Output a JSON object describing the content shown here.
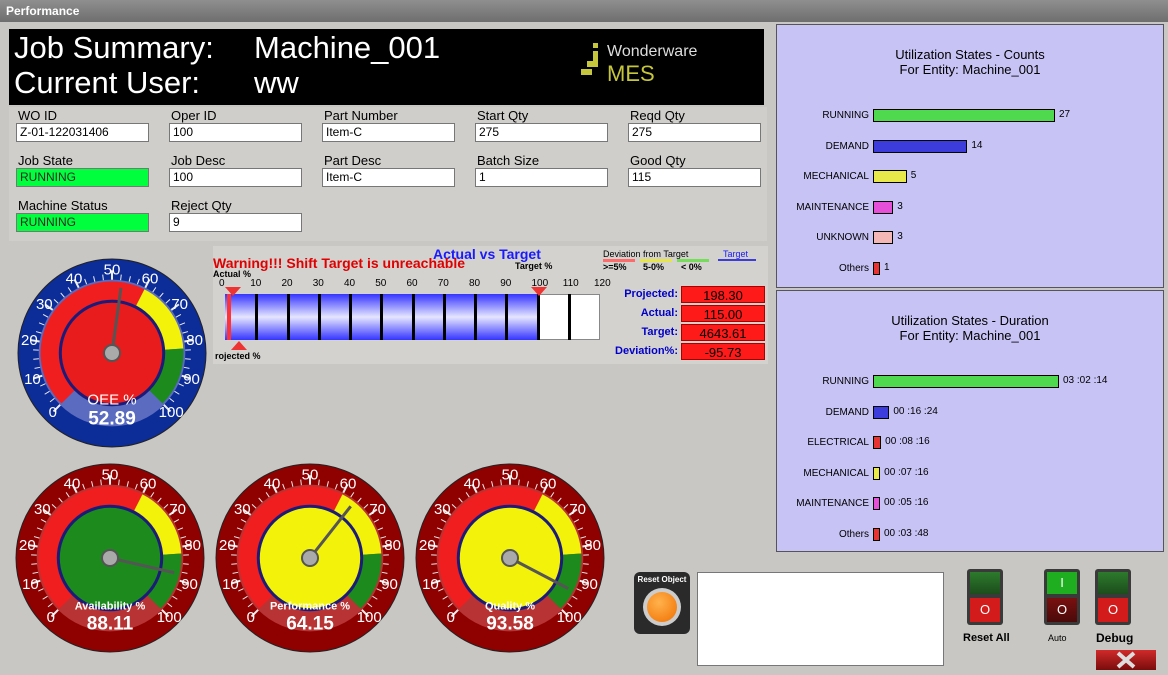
{
  "window": {
    "title": "Performance"
  },
  "header": {
    "job_label": "Job Summary:",
    "job_value": "Machine_001",
    "user_label": "Current User:",
    "user_value": "ww",
    "logo_top": "Wonderware",
    "logo_bottom": "MES"
  },
  "fields": {
    "wo_id": {
      "label": "WO ID",
      "value": "Z-01-122031406"
    },
    "oper_id": {
      "label": "Oper ID",
      "value": "100"
    },
    "part_number": {
      "label": "Part Number",
      "value": "Item-C"
    },
    "start_qty": {
      "label": "Start Qty",
      "value": "275"
    },
    "reqd_qty": {
      "label": "Reqd Qty",
      "value": "275"
    },
    "job_state": {
      "label": "Job State",
      "value": "RUNNING"
    },
    "job_desc": {
      "label": "Job Desc",
      "value": "100"
    },
    "part_desc": {
      "label": "Part Desc",
      "value": "Item-C"
    },
    "batch_size": {
      "label": "Batch Size",
      "value": "1"
    },
    "good_qty": {
      "label": "Good Qty",
      "value": "115"
    },
    "machine_status": {
      "label": "Machine Status",
      "value": "RUNNING"
    },
    "reject_qty": {
      "label": "Reject Qty",
      "value": "9"
    }
  },
  "actual_vs_target": {
    "title": "Actual vs Target",
    "warning": "Warning!!! Shift Target is unreachable",
    "actual_pct_label": "Actual %",
    "target_pct_label": "Target %",
    "projected_pct_label": "rojected %",
    "legend_title": "Deviation from Target",
    "legend_items": [
      ">=5%",
      "5-0%",
      "< 0%"
    ],
    "legend_target": "Target",
    "scale": [
      "0",
      "10",
      "20",
      "30",
      "40",
      "50",
      "60",
      "70",
      "80",
      "90",
      "100",
      "110",
      "120"
    ],
    "projected_value_pct": 198.3,
    "actual_value_pct": 100,
    "stats": [
      {
        "label": "Projected:",
        "value": "198.30"
      },
      {
        "label": "Actual:",
        "value": "115.00"
      },
      {
        "label": "Target:",
        "value": "4643.61"
      },
      {
        "label": "Deviation%:",
        "value": "-95.73"
      }
    ]
  },
  "gauges": {
    "ticks": [
      "0",
      "10",
      "20",
      "30",
      "40",
      "50",
      "60",
      "70",
      "80",
      "90",
      "100"
    ],
    "oee": {
      "label": "OEE %",
      "value": "52.89",
      "num": 52.89
    },
    "availability": {
      "label": "Availability %",
      "value": "88.11",
      "num": 88.11
    },
    "performance": {
      "label": "Performance %",
      "value": "64.15",
      "num": 64.15
    },
    "quality": {
      "label": "Quality %",
      "value": "93.58",
      "num": 93.58
    }
  },
  "counts_panel": {
    "title1": "Utilization States - Counts",
    "title2": "For Entity: Machine_001",
    "rows": [
      {
        "label": "RUNNING",
        "value": "27",
        "num": 27,
        "color": "#4fd94f"
      },
      {
        "label": "DEMAND",
        "value": "14",
        "num": 14,
        "color": "#3c3cdc"
      },
      {
        "label": "MECHANICAL",
        "value": "5",
        "num": 5,
        "color": "#e8e84a"
      },
      {
        "label": "MAINTENANCE",
        "value": "3",
        "num": 3,
        "color": "#e64fd7"
      },
      {
        "label": "UNKNOWN",
        "value": "3",
        "num": 3,
        "color": "#f5b6b6"
      },
      {
        "label": "Others",
        "value": "1",
        "num": 1,
        "color": "#e83333"
      }
    ]
  },
  "duration_panel": {
    "title1": "Utilization States - Duration",
    "title2": "For Entity: Machine_001",
    "rows": [
      {
        "label": "RUNNING",
        "value": "03 :02 :14",
        "num": 182,
        "color": "#4fd94f"
      },
      {
        "label": "DEMAND",
        "value": "00 :16 :24",
        "num": 16,
        "color": "#3c3cdc"
      },
      {
        "label": "ELECTRICAL",
        "value": "00 :08 :16",
        "num": 8,
        "color": "#e83333"
      },
      {
        "label": "MECHANICAL",
        "value": "00 :07 :16",
        "num": 7,
        "color": "#e8e84a"
      },
      {
        "label": "MAINTENANCE",
        "value": "00 :05 :16",
        "num": 5,
        "color": "#e64fd7"
      },
      {
        "label": "Others",
        "value": "00 :03 :48",
        "num": 4,
        "color": "#e83333"
      }
    ]
  },
  "controls": {
    "reset_object": "Reset Object",
    "reset_all": "Reset All",
    "auto": "Auto",
    "debug": "Debug",
    "switch_on": "I",
    "switch_off": "O"
  }
}
